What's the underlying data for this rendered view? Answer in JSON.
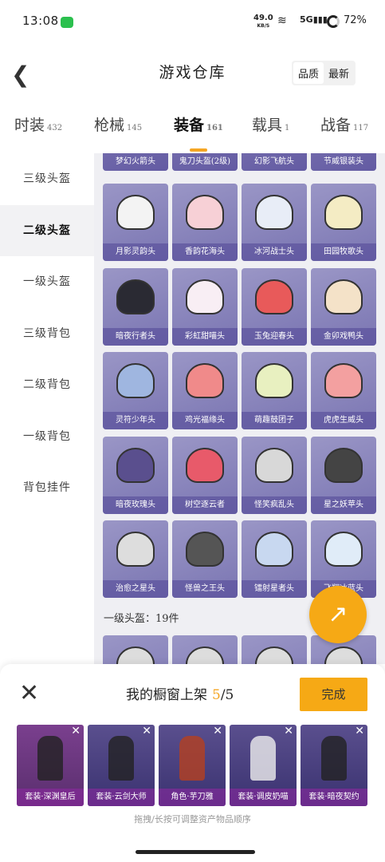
{
  "status_bar": {
    "time": "13:08",
    "speed_value": "49.0",
    "speed_unit": "KB/S",
    "network": "5G",
    "battery": "72%"
  },
  "header": {
    "title": "游戏仓库",
    "sort_options": [
      "品质",
      "最新"
    ],
    "active_sort": "品质"
  },
  "tabs": [
    {
      "label": "时装",
      "count": "432"
    },
    {
      "label": "枪械",
      "count": "145"
    },
    {
      "label": "装备",
      "count": "161"
    },
    {
      "label": "载具",
      "count": "1"
    },
    {
      "label": "战备",
      "count": "117"
    }
  ],
  "sidebar": {
    "items": [
      "三级头盔",
      "二级头盔",
      "一级头盔",
      "三级背包",
      "二级背包",
      "一级背包",
      "背包挂件"
    ],
    "active": "二级头盔"
  },
  "grid": {
    "top_row": [
      "梦幻火箭头",
      "鬼刀头盔(2级)",
      "幻影飞航头",
      "节威银装头"
    ],
    "rows": [
      [
        "月影灵韵头",
        "香韵花海头",
        "冰河战士头",
        "田园牧歌头"
      ],
      [
        "暗夜行者头",
        "彩虹甜喵头",
        "玉兔迎春头",
        "金卯戏鸭头"
      ],
      [
        "灵符少年头",
        "鸡光福缘头",
        "萌趣鼓团子",
        "虎虎生威头"
      ],
      [
        "暗夜玫瑰头",
        "树空逐云者",
        "怪笑疯乱头",
        "星之妖苹头"
      ],
      [
        "治愈之星头",
        "怪兽之王头",
        "镭射星者头",
        "飞翔冰蓝头"
      ]
    ],
    "section_title": "一级头盔：19件"
  },
  "sheet": {
    "title": "我的橱窗上架",
    "count_current": "5",
    "count_total": "/5",
    "done_label": "完成",
    "items": [
      "套装·深渊皇后",
      "套装·云剑大师",
      "角色·芋刀雅",
      "套装·调皮奶喵",
      "套装·暗夜契约"
    ],
    "hint": "拖拽/长按可调整资产物品顺序"
  },
  "colors": {
    "accent": "#f6a915",
    "card": "#8a86be"
  }
}
